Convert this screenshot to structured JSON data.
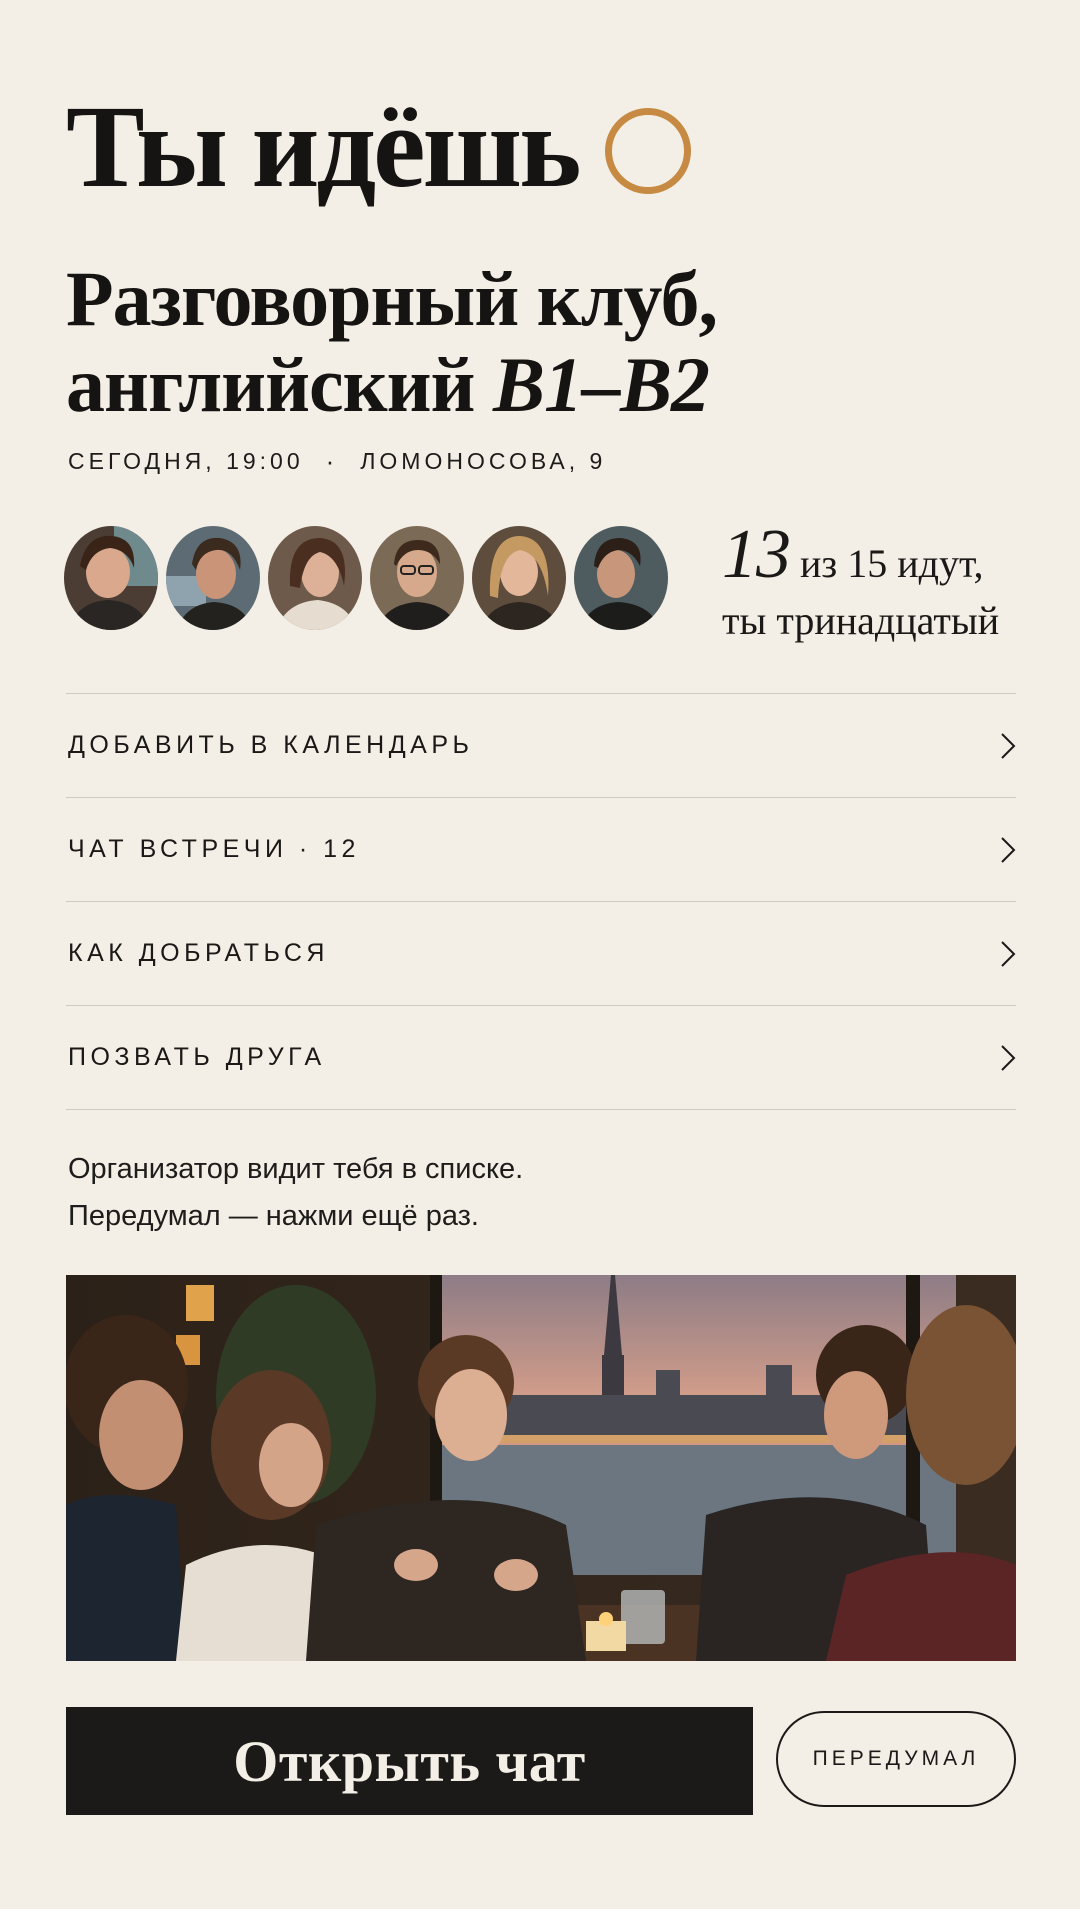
{
  "status": {
    "title": "Ты идёшь",
    "accent_color": "#c68a43",
    "indicator_icon": "ring-icon"
  },
  "event": {
    "title_main": "Разговорный клуб, английский ",
    "title_level": "B1–B2",
    "date_time": "СЕГОДНЯ, 19:00",
    "separator": "·",
    "address": "ЛОМОНОСОВА, 9"
  },
  "attendees": {
    "avatars": [
      "attendee-1",
      "attendee-2",
      "attendee-3",
      "attendee-4",
      "attendee-5",
      "attendee-6"
    ],
    "count": "13",
    "count_suffix": "из 15 идут,",
    "position_text": "ты тринадцатый"
  },
  "menu": {
    "items": [
      {
        "label": "ДОБАВИТЬ В КАЛЕНДАРЬ",
        "icon": "chevron-right-icon"
      },
      {
        "label": "ЧАТ ВСТРЕЧИ · 12",
        "icon": "chevron-right-icon"
      },
      {
        "label": "КАК ДОБРАТЬСЯ",
        "icon": "chevron-right-icon"
      },
      {
        "label": "ПОЗВАТЬ ДРУГА",
        "icon": "chevron-right-icon"
      }
    ]
  },
  "note": {
    "line1": "Организатор видит тебя в списке.",
    "line2": "Передумал — нажми ещё раз."
  },
  "actions": {
    "primary_label": "Открыть чат",
    "secondary_label": "ПЕРЕДУМАЛ"
  },
  "colors": {
    "background": "#f4efe6",
    "text": "#151412",
    "divider": "#cfc9bf",
    "button_dark": "#1b1a18"
  }
}
